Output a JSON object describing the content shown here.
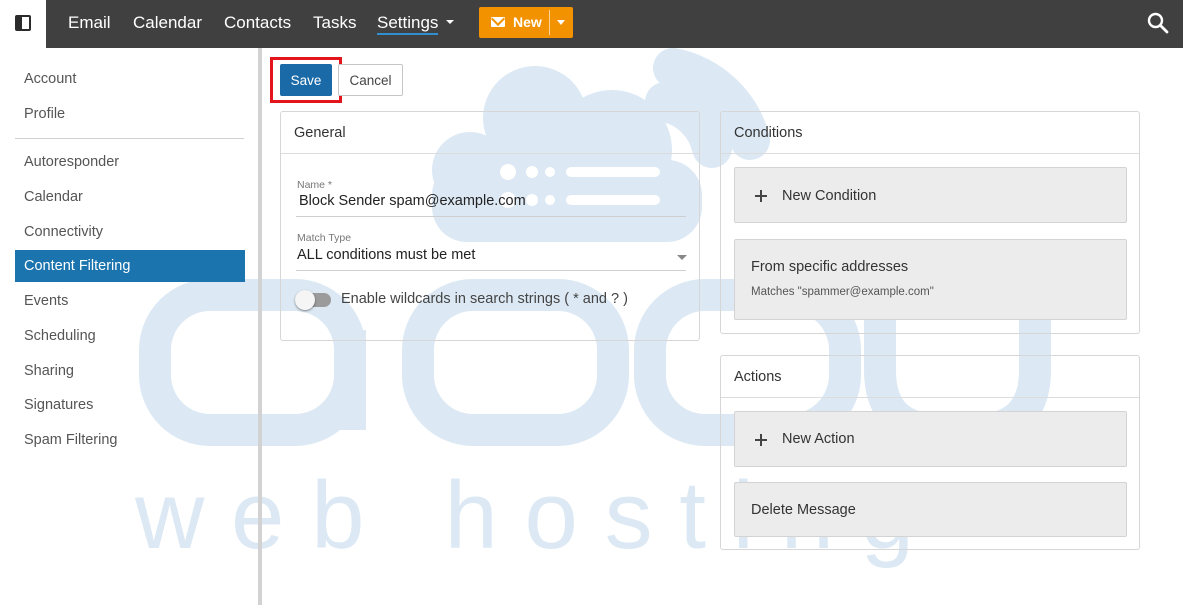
{
  "topnav": {
    "items": [
      "Email",
      "Calendar",
      "Contacts",
      "Tasks",
      "Settings"
    ],
    "new_label": "New"
  },
  "sidebar": {
    "items": [
      "Account",
      "Profile",
      "Autoresponder",
      "Calendar",
      "Connectivity",
      "Content Filtering",
      "Events",
      "Scheduling",
      "Sharing",
      "Signatures",
      "Spam Filtering"
    ],
    "active": "Content Filtering"
  },
  "toolbar": {
    "save_label": "Save",
    "cancel_label": "Cancel"
  },
  "general": {
    "title": "General",
    "name_label": "Name *",
    "name_value": "Block Sender spam@example.com",
    "match_label": "Match Type",
    "match_value": "ALL conditions must be met",
    "wildcard_label": "Enable wildcards in search strings ( * and ? )",
    "wildcard_enabled": false
  },
  "conditions": {
    "title": "Conditions",
    "new_label": "New Condition",
    "items": [
      {
        "title": "From specific addresses",
        "detail": "Matches \"spammer@example.com\""
      }
    ]
  },
  "actions": {
    "title": "Actions",
    "new_label": "New Action",
    "items": [
      "Delete Message"
    ]
  },
  "watermark": {
    "main": "accu",
    "sub": "w e b   h o s t i n g"
  },
  "colors": {
    "topbar": "#404040",
    "accent_orange": "#f39200",
    "active_blue": "#1b74ad",
    "save_blue": "#1b6aa8",
    "highlight_red": "#e3141b",
    "watermark": "#dce9f4"
  },
  "icons": [
    "sidebar-toggle-icon",
    "envelope-icon",
    "chevron-down-icon",
    "search-icon",
    "plus-icon"
  ]
}
